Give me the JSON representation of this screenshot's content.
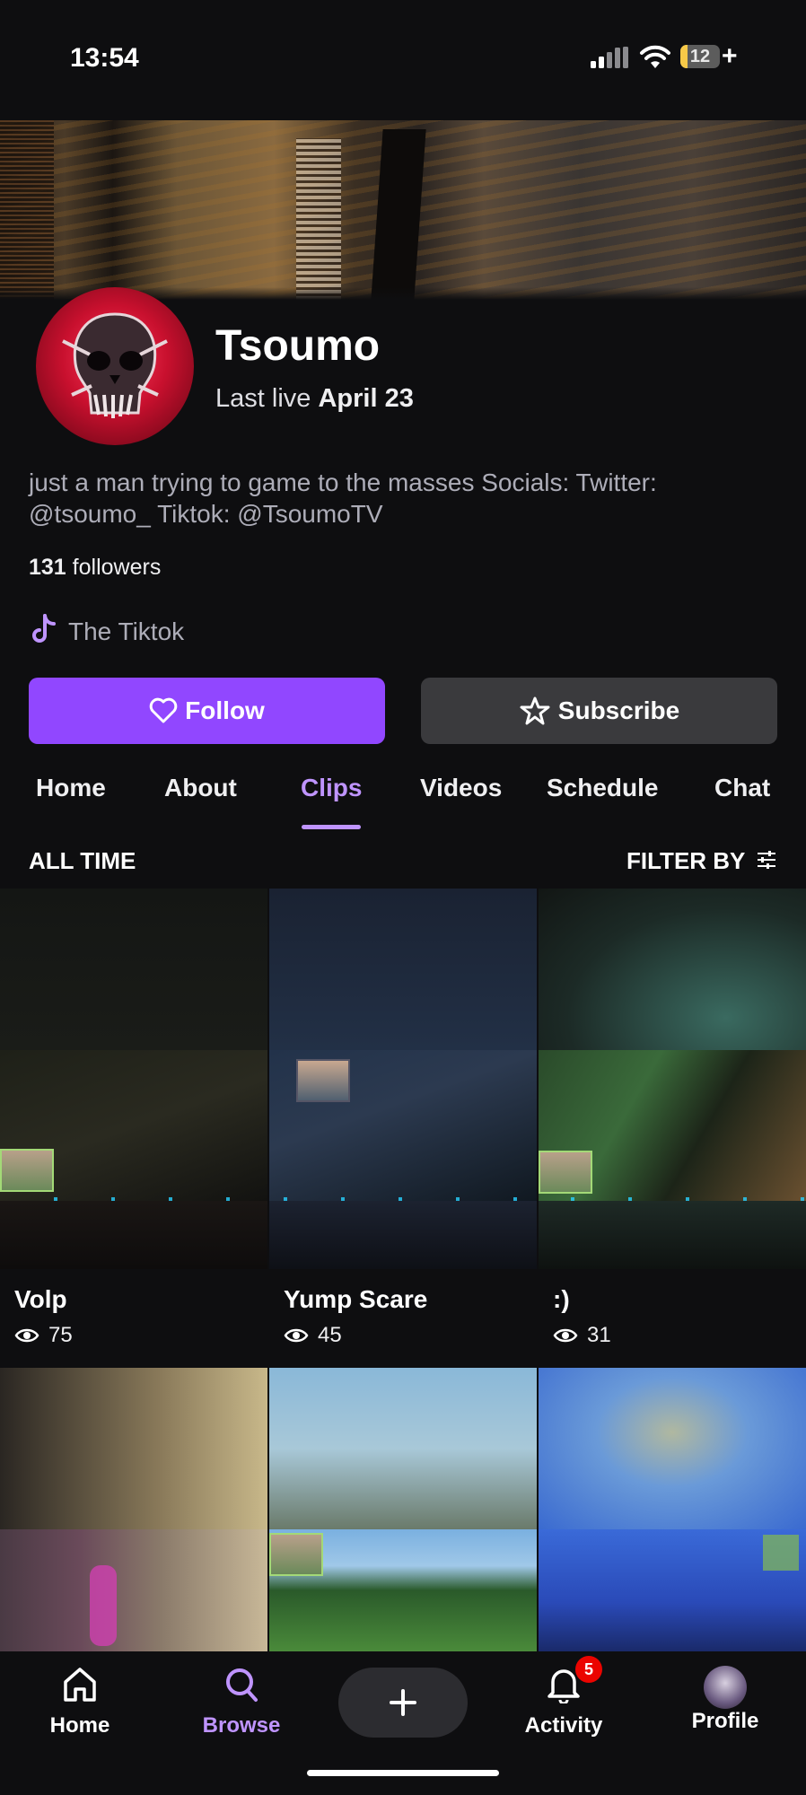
{
  "status_bar": {
    "time": "13:54",
    "battery": "12"
  },
  "channel": {
    "name": "Tsoumo",
    "last_live_prefix": "Last live",
    "last_live_date": "April 23",
    "bio": "just a man trying to game to the masses Socials: Twitter: @tsoumo_ Tiktok: @TsoumoTV",
    "followers_count": "131",
    "followers_label": "followers",
    "social_link": "The Tiktok",
    "accent_color": "#9147ff"
  },
  "actions": {
    "follow": "Follow",
    "subscribe": "Subscribe"
  },
  "tabs": [
    {
      "label": "Home",
      "active": false
    },
    {
      "label": "About",
      "active": false
    },
    {
      "label": "Clips",
      "active": true
    },
    {
      "label": "Videos",
      "active": false
    },
    {
      "label": "Schedule",
      "active": false
    },
    {
      "label": "Chat",
      "active": false
    }
  ],
  "clips_header": {
    "range": "ALL TIME",
    "filter": "FILTER BY"
  },
  "clips": [
    {
      "title": "Volp",
      "views": "75"
    },
    {
      "title": "Yump Scare",
      "views": "45"
    },
    {
      "title": ":)",
      "views": "31"
    }
  ],
  "bottom_nav": {
    "home": "Home",
    "browse": "Browse",
    "activity": "Activity",
    "activity_badge": "5",
    "profile": "Profile"
  }
}
